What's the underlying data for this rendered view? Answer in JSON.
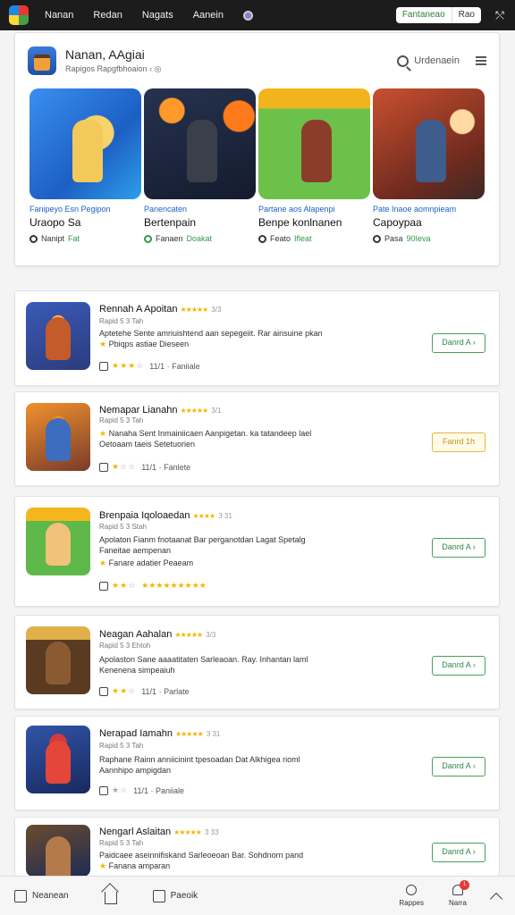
{
  "nav": {
    "links": [
      "Nanan",
      "Redan",
      "Nagats",
      "Aanein"
    ],
    "toggle_active": "Fantaneao",
    "toggle_other": "Rao"
  },
  "featured": {
    "title": "Nanan, AAgiai",
    "subtitle": "Rapigos Rapgfbhoaion ‹ ◎",
    "search_label": "Urdenaein",
    "tiles": [
      {
        "tag": "Fanipeyo Esn Pegipon",
        "name": "Uraopo Sa",
        "meta_a": "Nanipt",
        "meta_b": "Fat",
        "icon_green": false
      },
      {
        "tag": "Panencaten",
        "name": "Bertenpain",
        "meta_a": "Fanaen",
        "meta_b": "Doakat",
        "icon_green": true
      },
      {
        "tag": "Partane aos Alapenpi",
        "name": "Benpe konlnanen",
        "meta_a": "Feato",
        "meta_b": "Ifleat",
        "icon_green": false
      },
      {
        "tag": "Pate Inaoe aomnpieam",
        "name": "Capoypaa",
        "meta_a": "Pasa",
        "meta_b": "90Ieva",
        "icon_green": false
      }
    ]
  },
  "apps": [
    {
      "title": "Rennah A Apoitan",
      "stars": "★★★★★",
      "rating": "3/3",
      "sub": "Rapid 5 3 Tah",
      "desc1": "Aptetehe Sente amriuishtend aan sepegeiit. Rar ainsuine pkan",
      "desc2": "Pbiqps astiae Dieseen",
      "foot": "11/1 · Faniiale",
      "button": "Danrd A ›",
      "button_style": "green",
      "foot_on": 3
    },
    {
      "title": "Nemapar Lianahn",
      "stars": "★★★★★",
      "rating": "3/1",
      "sub": "Rapid 5 3 Tah",
      "desc1": "Nanaha Sent Inmainiicaen Aanpigetan. ka tatandeep lael",
      "desc2": "Oetoaam taeis Setetuorien",
      "foot": "11/1 · Fanlete",
      "button": "Fanrd 1h",
      "button_style": "yellow",
      "foot_on": 1
    },
    {
      "title": "Brenpaia Iqoloaedan",
      "stars": "★★★★",
      "rating": "3 31",
      "sub": "Rapid 5 3 Stah",
      "desc1": "Apolaton Fianm fnotaanat Bar perganotdan Lagat Spetalg",
      "desc2": "Faneitae aempenan",
      "desc3": "Fanare adatier Peaeam",
      "foot": "★★★★★★★★★",
      "button": "Danrd A ›",
      "button_style": "green",
      "foot_on": 2
    },
    {
      "title": "Neagan Aahalan",
      "stars": "★★★★★",
      "rating": "3/3",
      "sub": "Rapid 5 3 Ehtoh",
      "desc1": "Apolaston Sane aaaatitaten Sarleaoan. Ray. Inhantan laml",
      "desc2": "Kenenena simpeaiuh",
      "foot": "11/1 · Parlate",
      "button": "Danrd A ›",
      "button_style": "green",
      "foot_on": 2
    },
    {
      "title": "Nerapad Iamahn",
      "stars": "★★★★★",
      "rating": "3 31",
      "sub": "Rapid 5 3 Tah",
      "desc1": "Raphane Rainn anniicinint tpesoadan Dat Alkhigea rioml",
      "desc2": "Aannhipo ampigdan",
      "foot": "11/1 · Paniiale",
      "button": "Danrd A ›",
      "button_style": "green",
      "foot_on": 0
    },
    {
      "title": "Nengarl Aslaitan",
      "stars": "★★★★★",
      "rating": "3 33",
      "sub": "Rapid 5 3 Tah",
      "desc1": "Paidcaee aseinnifiskand Sarleoeoan Bar. Sohdnorn pand",
      "desc2": "Fanana amparan",
      "foot": "",
      "button": "Danrd A ›",
      "button_style": "green",
      "foot_on": 0
    }
  ],
  "bottom": {
    "left_label": "Neanean",
    "middle_label": "Paeoik",
    "right1_label": "Rappes",
    "right2_label": "Narra",
    "badge": "1"
  }
}
